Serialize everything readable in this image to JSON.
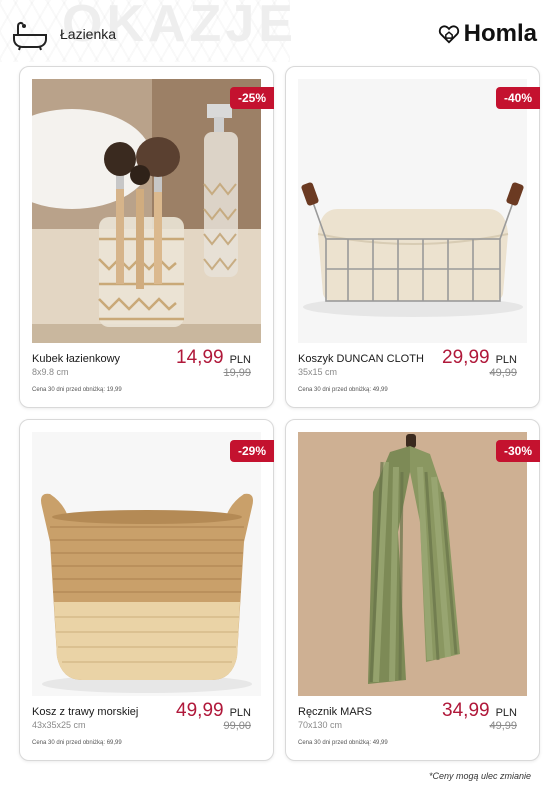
{
  "header": {
    "category": "Łazienka",
    "watermark": "OKAZJE",
    "brand": "Homla",
    "icons": {
      "category": "bathtub-icon",
      "brand": "heart-house-icon"
    }
  },
  "colors": {
    "accent": "#c4122f",
    "price": "#b0183a"
  },
  "products": [
    {
      "name": "Kubek łazienkowy",
      "dims": "8x9.8 cm",
      "price": "14,99",
      "currency": "PLN",
      "old_price": "19,99",
      "discount": "-25%",
      "note": "Cena 30 dni przed obniżką: 19,99"
    },
    {
      "name": "Koszyk DUNCAN CLOTH",
      "dims": "35x15 cm",
      "price": "29,99",
      "currency": "PLN",
      "old_price": "49,99",
      "discount": "-40%",
      "note": "Cena 30 dni przed obniżką: 49,99"
    },
    {
      "name": "Kosz z trawy morskiej",
      "dims": "43x35x25 cm",
      "price": "49,99",
      "currency": "PLN",
      "old_price": "99,00",
      "discount": "-29%",
      "note": "Cena 30 dni przed obniżką: 69,99"
    },
    {
      "name": "Ręcznik MARS",
      "dims": "70x130 cm",
      "price": "34,99",
      "currency": "PLN",
      "old_price": "49,99",
      "discount": "-30%",
      "note": "Cena 30 dni przed obniżką: 49,99"
    }
  ],
  "footer": {
    "note": "*Ceny mogą ulec zmianie"
  }
}
